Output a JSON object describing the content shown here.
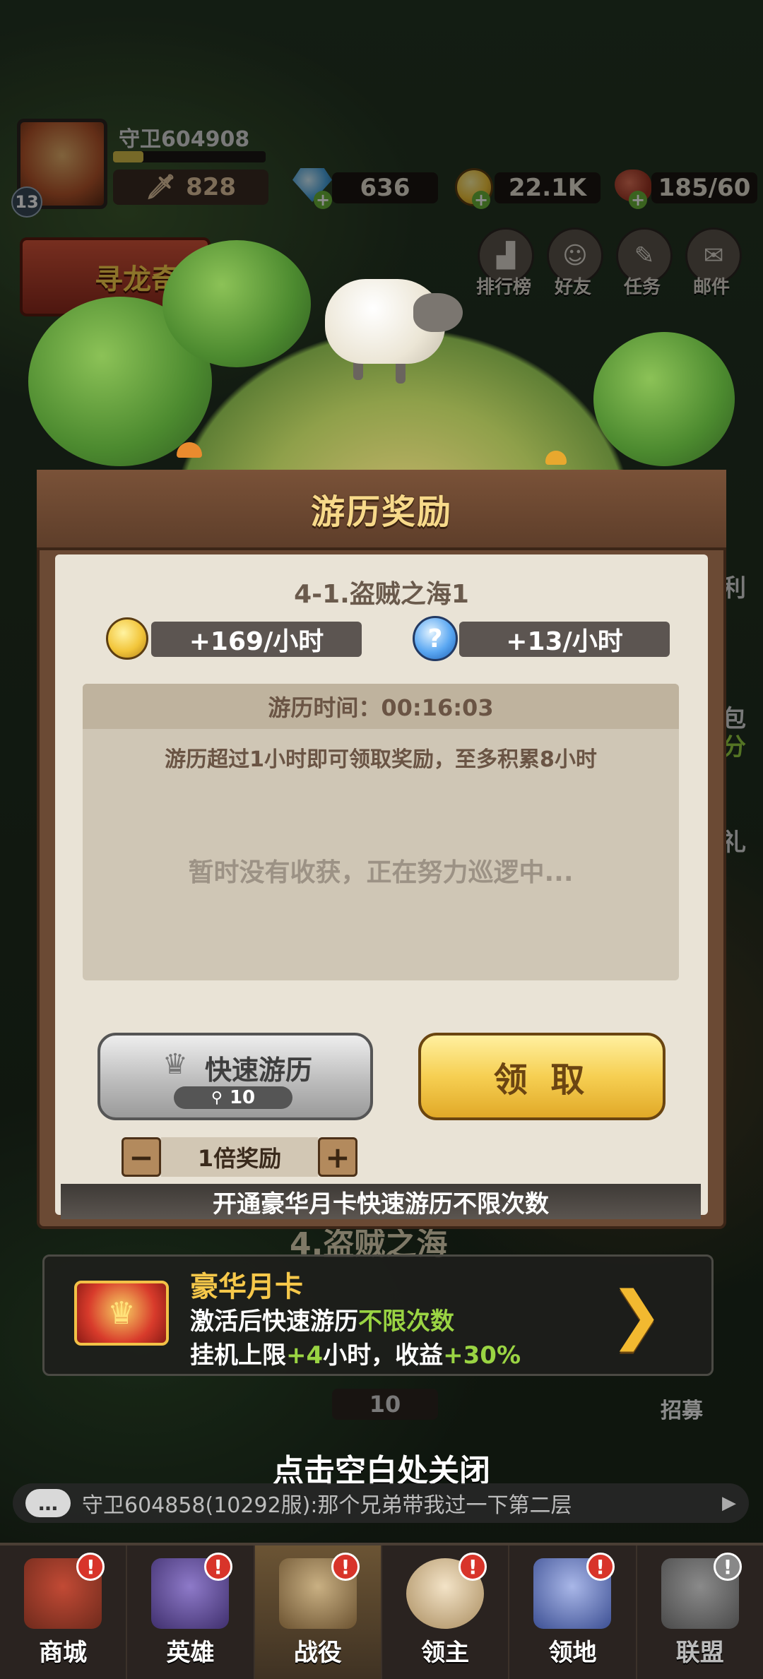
{
  "hud": {
    "player_name": "守卫604908",
    "level": "13",
    "power": "828",
    "gems": "636",
    "gold": "22.1K",
    "stamina": "185/60"
  },
  "side_buttons": [
    "排行榜",
    "好友",
    "任务",
    "邮件"
  ],
  "left_event": "寻龙奇",
  "right_fragments": [
    "利",
    "包",
    "分",
    "礼"
  ],
  "modal": {
    "title": "游历奖励",
    "stage": "4-1.盗贼之海1",
    "gold_rate": "+169/小时",
    "exp_rate": "+13/小时",
    "exp_icon_glyph": "?",
    "time_label": "游历时间：00:16:03",
    "rule_text": "游历超过1小时即可领取奖励，至多积累8小时",
    "empty_text": "暂时没有收获，正在努力巡逻中...",
    "quick_button_label": "快速游历",
    "quick_cost": "10",
    "claim_button_label": "领 取",
    "multiplier_label": "1倍奖励",
    "minus": "−",
    "plus": "+",
    "card_strip": "开通豪华月卡快速游历不限次数"
  },
  "promo": {
    "title": "豪华月卡",
    "line1_prefix": "激活后快速游历",
    "line1_highlight": "不限次数",
    "line2_prefix": "挂机上限",
    "line2_hl1": "+4",
    "line2_mid": "小时，收益",
    "line2_hl2": "+30%",
    "arrow": "❯"
  },
  "background": {
    "stage_title": "4.盗贼之海",
    "cost": "10",
    "recruit": "招募"
  },
  "close_hint": "点击空白处关闭",
  "chat_message": "守卫604858(10292服):那个兄弟带我过一下第二层",
  "nav": [
    {
      "label": "商城",
      "badge": "!"
    },
    {
      "label": "英雄",
      "badge": "!"
    },
    {
      "label": "战役",
      "badge": "!"
    },
    {
      "label": "领主",
      "badge": "!"
    },
    {
      "label": "领地",
      "badge": "!"
    },
    {
      "label": "联盟",
      "badge": "!"
    }
  ],
  "colors": {
    "title_gold": "#f7d98a",
    "highlight_green": "#9ad443",
    "badge_red": "#d8342a"
  }
}
